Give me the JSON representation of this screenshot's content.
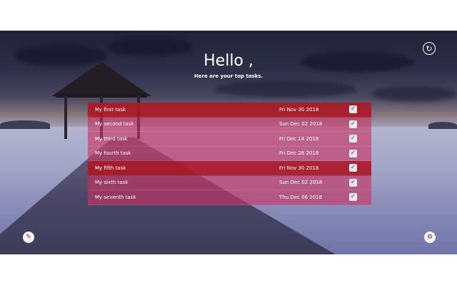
{
  "header": {
    "greeting": "Hello ,",
    "subtitle": "Here are your top tasks."
  },
  "icons": {
    "refresh": "refresh-icon",
    "edit": "pencil-icon",
    "settings": "gear-icon",
    "check": "check-icon"
  },
  "colors": {
    "row_bg": "#c83264",
    "row_highlight": "#aa1928",
    "accent": "#a01c44"
  },
  "tasks": [
    {
      "name": "My first task",
      "date": "Fri Nov 30 2018",
      "highlighted": true
    },
    {
      "name": "My second task",
      "date": "Sun Dec 02 2018",
      "highlighted": false
    },
    {
      "name": "My third task",
      "date": "Fri Dec 14 2018",
      "highlighted": false
    },
    {
      "name": "My fourth task",
      "date": "Fri Dec 28 2018",
      "highlighted": false
    },
    {
      "name": "My fifth task",
      "date": "Fri Nov 30 2018",
      "highlighted": true
    },
    {
      "name": "My sixth task",
      "date": "Sun Dec 02 2018",
      "highlighted": false
    },
    {
      "name": "My seventh task",
      "date": "Thu Dec 06 2018",
      "highlighted": false
    }
  ]
}
